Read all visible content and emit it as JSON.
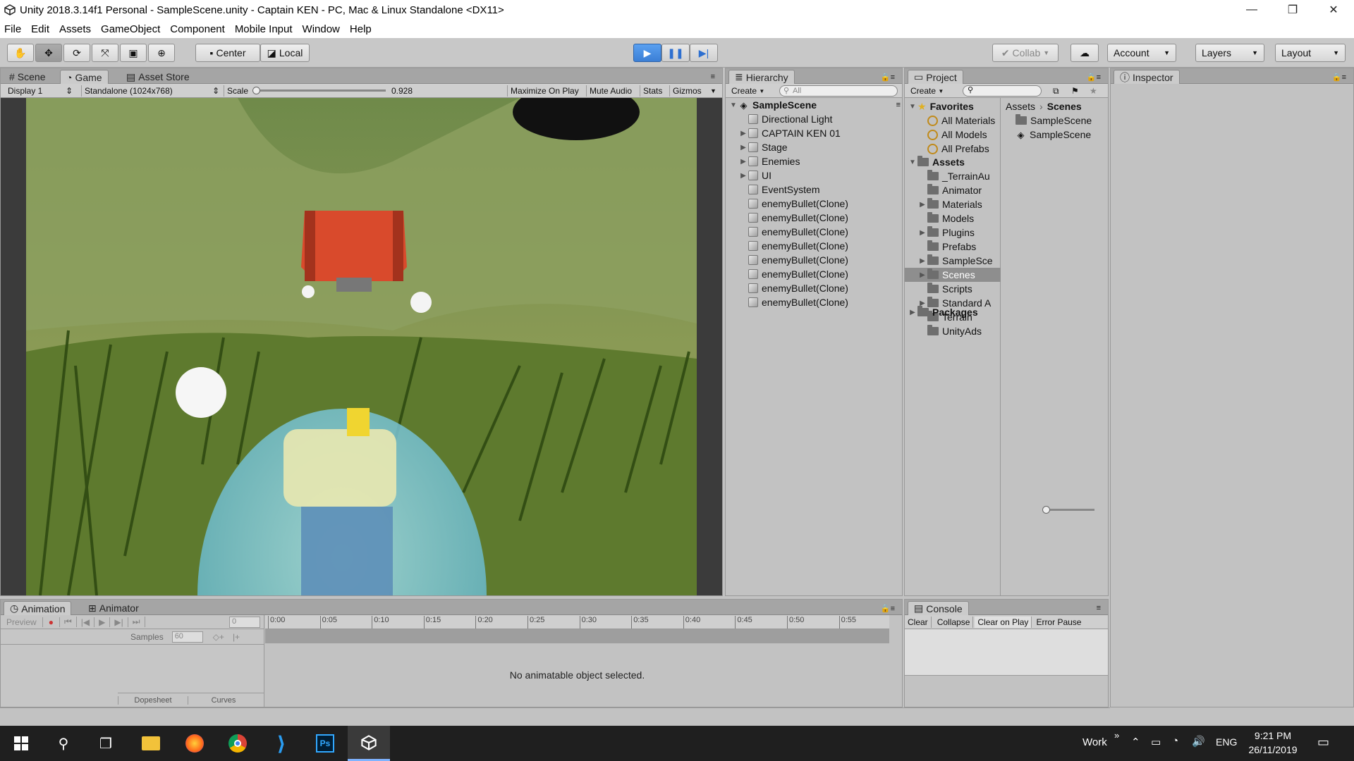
{
  "window": {
    "title": "Unity 2018.3.14f1 Personal - SampleScene.unity - Captain KEN - PC, Mac & Linux Standalone <DX11>",
    "minimize": "—",
    "maximize": "❐",
    "close": "✕"
  },
  "menu": [
    "File",
    "Edit",
    "Assets",
    "GameObject",
    "Component",
    "Mobile Input",
    "Window",
    "Help"
  ],
  "toolbar": {
    "pivot_center": "Center",
    "pivot_local": "Local",
    "collab": "Collab",
    "account": "Account",
    "layers": "Layers",
    "layout": "Layout"
  },
  "game_panel": {
    "tabs": [
      "Scene",
      "Game",
      "Asset Store"
    ],
    "display": "Display 1",
    "resolution": "Standalone (1024x768)",
    "scale_label": "Scale",
    "scale_value": "0.928",
    "scale_fraction": 0.928,
    "buttons": [
      "Maximize On Play",
      "Mute Audio",
      "Stats",
      "Gizmos"
    ]
  },
  "hierarchy": {
    "tab": "Hierarchy",
    "create": "Create",
    "search_placeholder": "All",
    "scene": "SampleScene",
    "items": [
      {
        "label": "Directional Light",
        "expandable": false
      },
      {
        "label": "CAPTAIN KEN 01",
        "expandable": true
      },
      {
        "label": "Stage",
        "expandable": true
      },
      {
        "label": "Enemies",
        "expandable": true
      },
      {
        "label": "UI",
        "expandable": true
      },
      {
        "label": "EventSystem",
        "expandable": false
      },
      {
        "label": "enemyBullet(Clone)",
        "expandable": false
      },
      {
        "label": "enemyBullet(Clone)",
        "expandable": false
      },
      {
        "label": "enemyBullet(Clone)",
        "expandable": false
      },
      {
        "label": "enemyBullet(Clone)",
        "expandable": false
      },
      {
        "label": "enemyBullet(Clone)",
        "expandable": false
      },
      {
        "label": "enemyBullet(Clone)",
        "expandable": false
      },
      {
        "label": "enemyBullet(Clone)",
        "expandable": false
      },
      {
        "label": "enemyBullet(Clone)",
        "expandable": false
      }
    ]
  },
  "project": {
    "tab": "Project",
    "create": "Create",
    "favorites_label": "Favorites",
    "favorites": [
      "All Materials",
      "All Models",
      "All Prefabs"
    ],
    "assets_label": "Assets",
    "assets": [
      {
        "label": "_TerrainAu",
        "expandable": false
      },
      {
        "label": "Animator",
        "expandable": false
      },
      {
        "label": "Materials",
        "expandable": true
      },
      {
        "label": "Models",
        "expandable": false
      },
      {
        "label": "Plugins",
        "expandable": true
      },
      {
        "label": "Prefabs",
        "expandable": false
      },
      {
        "label": "SampleSce",
        "expandable": true
      },
      {
        "label": "Scenes",
        "expandable": true,
        "selected": true
      },
      {
        "label": "Scripts",
        "expandable": false
      },
      {
        "label": "Standard A",
        "expandable": true
      },
      {
        "label": "Terrain",
        "expandable": false
      },
      {
        "label": "UnityAds",
        "expandable": false
      }
    ],
    "packages_label": "Packages",
    "breadcrumb": [
      "Assets",
      "Scenes"
    ],
    "files": [
      "SampleScene",
      "SampleScene"
    ]
  },
  "inspector": {
    "tab": "Inspector"
  },
  "animation": {
    "tabs": [
      "Animation",
      "Animator"
    ],
    "preview": "Preview",
    "frame": "0",
    "samples_label": "Samples",
    "samples_value": "60",
    "timeline": [
      "0:00",
      "0:05",
      "0:10",
      "0:15",
      "0:20",
      "0:25",
      "0:30",
      "0:35",
      "0:40",
      "0:45",
      "0:50",
      "0:55"
    ],
    "empty_message": "No animatable object selected.",
    "bottom_tabs": [
      "Dopesheet",
      "Curves"
    ]
  },
  "console": {
    "tab": "Console",
    "buttons": [
      "Clear",
      "Collapse",
      "Clear on Play",
      "Error Pause"
    ]
  },
  "taskbar": {
    "work": "Work",
    "chevron": "»",
    "lang": "ENG",
    "time": "9:21 PM",
    "date": "26/11/2019",
    "ps_label": "Ps"
  }
}
